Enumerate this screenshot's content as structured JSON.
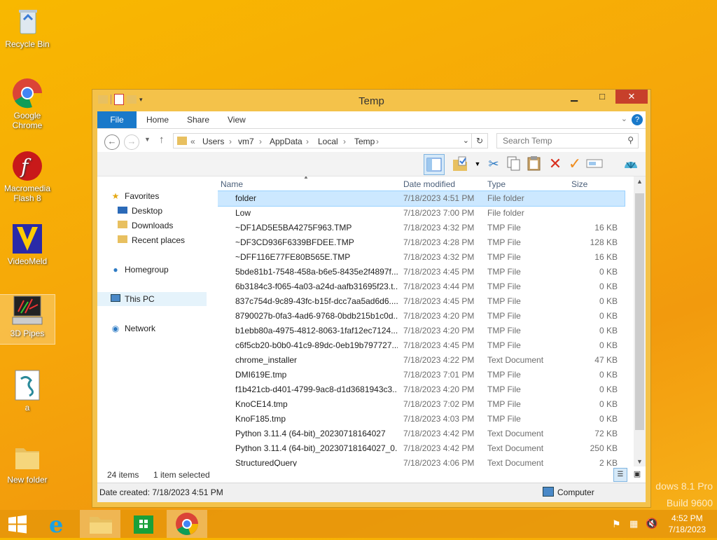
{
  "desktop": {
    "icons": [
      {
        "label": "Recycle Bin",
        "icon": "recycle-bin-icon"
      },
      {
        "label": "Google Chrome",
        "icon": "chrome-icon"
      },
      {
        "label": "Macromedia Flash 8",
        "icon": "flash-icon"
      },
      {
        "label": "VideoMeld",
        "icon": "videomeld-icon"
      },
      {
        "label": "3D Pipes",
        "icon": "screensaver-icon"
      },
      {
        "label": "a",
        "icon": "script-icon"
      },
      {
        "label": "New folder",
        "icon": "folder-icon"
      }
    ],
    "watermark_line1": "dows 8.1 Pro",
    "watermark_line2": "Build 9600"
  },
  "window": {
    "title": "Temp",
    "ribbon_tabs": [
      "File",
      "Home",
      "Share",
      "View"
    ],
    "breadcrumb": [
      "«",
      "Users",
      "›",
      "vm7",
      "›",
      "AppData",
      "›",
      "Local",
      "›",
      "Temp",
      "›"
    ],
    "search_placeholder": "Search Temp",
    "columns": {
      "name": "Name",
      "date": "Date modified",
      "type": "Type",
      "size": "Size"
    },
    "nav": {
      "favorites": "Favorites",
      "desktop": "Desktop",
      "downloads": "Downloads",
      "recent": "Recent places",
      "homegroup": "Homegroup",
      "thispc": "This PC",
      "network": "Network"
    },
    "files": [
      {
        "name": "folder",
        "date": "7/18/2023 4:51 PM",
        "type": "File folder",
        "size": "",
        "kind": "folder"
      },
      {
        "name": "Low",
        "date": "7/18/2023 7:00 PM",
        "type": "File folder",
        "size": "",
        "kind": "folder"
      },
      {
        "name": "~DF1AD5E5BA4275F963.TMP",
        "date": "7/18/2023 4:32 PM",
        "type": "TMP File",
        "size": "16 KB",
        "kind": "file"
      },
      {
        "name": "~DF3CD936F6339BFDEE.TMP",
        "date": "7/18/2023 4:28 PM",
        "type": "TMP File",
        "size": "128 KB",
        "kind": "file"
      },
      {
        "name": "~DFF116E77FE80B565E.TMP",
        "date": "7/18/2023 4:32 PM",
        "type": "TMP File",
        "size": "16 KB",
        "kind": "file"
      },
      {
        "name": "5bde81b1-7548-458a-b6e5-8435e2f4897f....",
        "date": "7/18/2023 4:45 PM",
        "type": "TMP File",
        "size": "0 KB",
        "kind": "file"
      },
      {
        "name": "6b3184c3-f065-4a03-a24d-aafb31695f23.t...",
        "date": "7/18/2023 4:44 PM",
        "type": "TMP File",
        "size": "0 KB",
        "kind": "file"
      },
      {
        "name": "837c754d-9c89-43fc-b15f-dcc7aa5ad6d6....",
        "date": "7/18/2023 4:45 PM",
        "type": "TMP File",
        "size": "0 KB",
        "kind": "file"
      },
      {
        "name": "8790027b-0fa3-4ad6-9768-0bdb215b1c0d...",
        "date": "7/18/2023 4:20 PM",
        "type": "TMP File",
        "size": "0 KB",
        "kind": "file"
      },
      {
        "name": "b1ebb80a-4975-4812-8063-1faf12ec7124....",
        "date": "7/18/2023 4:20 PM",
        "type": "TMP File",
        "size": "0 KB",
        "kind": "file"
      },
      {
        "name": "c6f5cb20-b0b0-41c9-89dc-0eb19b797727...",
        "date": "7/18/2023 4:45 PM",
        "type": "TMP File",
        "size": "0 KB",
        "kind": "file"
      },
      {
        "name": "chrome_installer",
        "date": "7/18/2023 4:22 PM",
        "type": "Text Document",
        "size": "47 KB",
        "kind": "doc"
      },
      {
        "name": "DMI619E.tmp",
        "date": "7/18/2023 7:01 PM",
        "type": "TMP File",
        "size": "0 KB",
        "kind": "file"
      },
      {
        "name": "f1b421cb-d401-4799-9ac8-d1d3681943c3...",
        "date": "7/18/2023 4:20 PM",
        "type": "TMP File",
        "size": "0 KB",
        "kind": "file"
      },
      {
        "name": "KnoCE14.tmp",
        "date": "7/18/2023 7:02 PM",
        "type": "TMP File",
        "size": "0 KB",
        "kind": "file"
      },
      {
        "name": "KnoF185.tmp",
        "date": "7/18/2023 4:03 PM",
        "type": "TMP File",
        "size": "0 KB",
        "kind": "file"
      },
      {
        "name": "Python 3.11.4 (64-bit)_20230718164027",
        "date": "7/18/2023 4:42 PM",
        "type": "Text Document",
        "size": "72 KB",
        "kind": "doc"
      },
      {
        "name": "Python 3.11.4 (64-bit)_20230718164027_0...",
        "date": "7/18/2023 4:42 PM",
        "type": "Text Document",
        "size": "250 KB",
        "kind": "doc"
      },
      {
        "name": "StructuredQuery",
        "date": "7/18/2023 4:06 PM",
        "type": "Text Document",
        "size": "2 KB",
        "kind": "doc"
      }
    ],
    "status": {
      "count": "24 items",
      "selected": "1 item selected"
    },
    "info": {
      "created": "Date created: 7/18/2023 4:51 PM",
      "location": "Computer"
    }
  },
  "taskbar": {
    "apps": [
      "start-button",
      "internet-explorer",
      "file-explorer",
      "store",
      "chrome"
    ],
    "time": "4:52 PM",
    "date": "7/18/2023"
  }
}
